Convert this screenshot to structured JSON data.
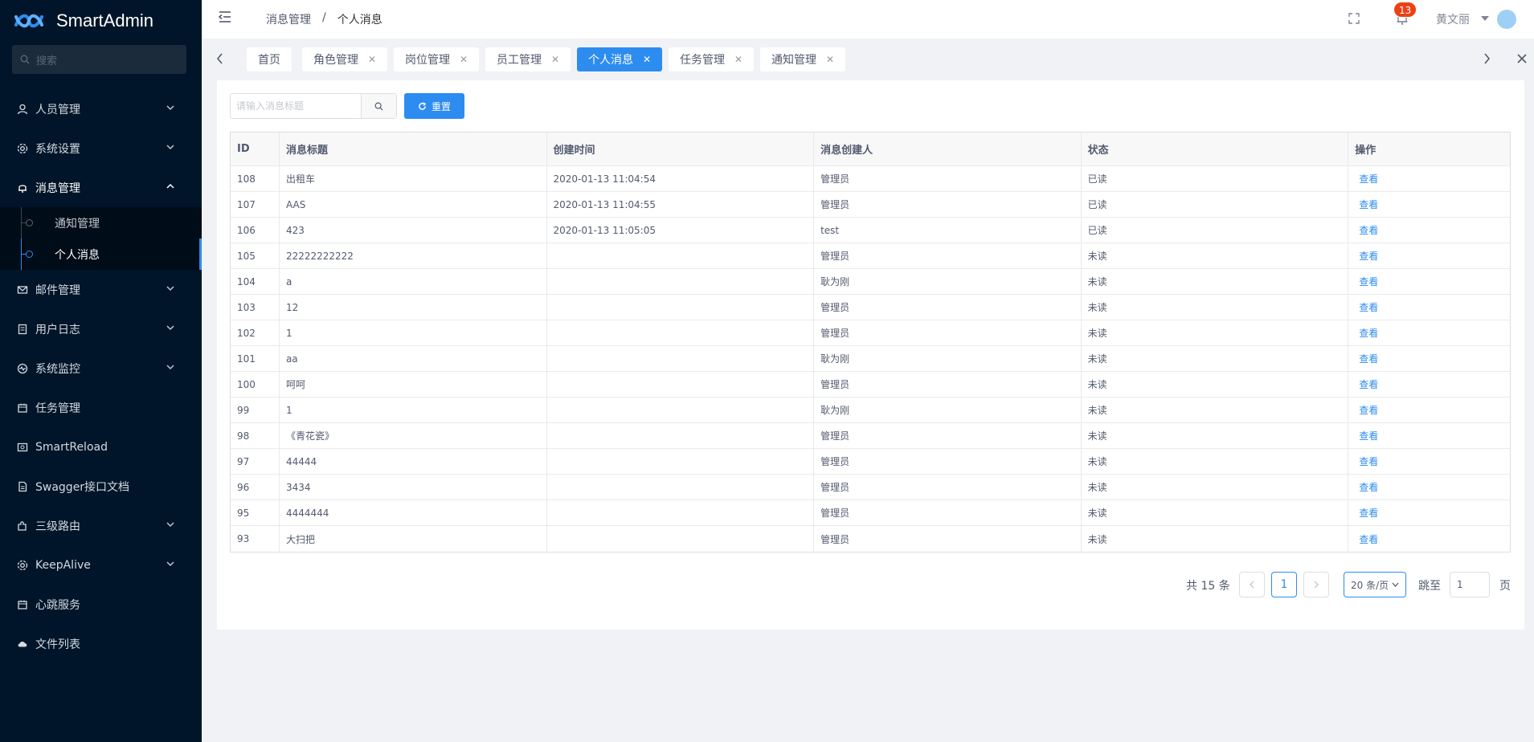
{
  "app": {
    "title": "SmartAdmin"
  },
  "sidebar": {
    "search_placeholder": "搜索",
    "items": [
      {
        "label": "人员管理",
        "icon": "user-icon",
        "expandable": true
      },
      {
        "label": "系统设置",
        "icon": "gear-icon",
        "expandable": true
      },
      {
        "label": "消息管理",
        "icon": "bell-icon",
        "expandable": true,
        "open": true
      },
      {
        "label": "邮件管理",
        "icon": "mail-icon",
        "expandable": true
      },
      {
        "label": "用户日志",
        "icon": "log-icon",
        "expandable": true
      },
      {
        "label": "系统监控",
        "icon": "monitor-icon",
        "expandable": true
      },
      {
        "label": "任务管理",
        "icon": "calendar-icon",
        "expandable": false
      },
      {
        "label": "SmartReload",
        "icon": "reload-icon",
        "expandable": false
      },
      {
        "label": "Swagger接口文档",
        "icon": "doc-icon",
        "expandable": false
      },
      {
        "label": "三级路由",
        "icon": "puzzle-icon",
        "expandable": true
      },
      {
        "label": "KeepAlive",
        "icon": "gear-icon",
        "expandable": true
      },
      {
        "label": "心跳服务",
        "icon": "heartbeat-icon",
        "expandable": false
      },
      {
        "label": "文件列表",
        "icon": "cloud-icon",
        "expandable": false
      }
    ],
    "submenu": [
      {
        "label": "通知管理",
        "active": false
      },
      {
        "label": "个人消息",
        "active": true
      }
    ]
  },
  "header": {
    "breadcrumb": [
      "消息管理",
      "/",
      "个人消息"
    ],
    "notification_count": "13",
    "user_name": "黄文丽"
  },
  "tabs": [
    {
      "label": "首页",
      "closable": false,
      "active": false
    },
    {
      "label": "角色管理",
      "closable": true,
      "active": false
    },
    {
      "label": "岗位管理",
      "closable": true,
      "active": false
    },
    {
      "label": "员工管理",
      "closable": true,
      "active": false
    },
    {
      "label": "个人消息",
      "closable": true,
      "active": true
    },
    {
      "label": "任务管理",
      "closable": true,
      "active": false
    },
    {
      "label": "通知管理",
      "closable": true,
      "active": false
    }
  ],
  "filters": {
    "search_placeholder": "请输入消息标题",
    "reset_label": "重置"
  },
  "table": {
    "columns": [
      "ID",
      "消息标题",
      "创建时间",
      "消息创建人",
      "状态",
      "操作"
    ],
    "action_label": "查看",
    "rows": [
      [
        "108",
        "出租车",
        "2020-01-13 11:04:54",
        "管理员",
        "已读"
      ],
      [
        "107",
        "AAS",
        "2020-01-13 11:04:55",
        "管理员",
        "已读"
      ],
      [
        "106",
        "423",
        "2020-01-13 11:05:05",
        "test",
        "已读"
      ],
      [
        "105",
        "22222222222",
        "",
        "管理员",
        "未读"
      ],
      [
        "104",
        "a",
        "",
        "耿为刚",
        "未读"
      ],
      [
        "103",
        "12",
        "",
        "管理员",
        "未读"
      ],
      [
        "102",
        "1",
        "",
        "管理员",
        "未读"
      ],
      [
        "101",
        "aa",
        "",
        "耿为刚",
        "未读"
      ],
      [
        "100",
        "呵呵",
        "",
        "管理员",
        "未读"
      ],
      [
        "99",
        "1",
        "",
        "耿为刚",
        "未读"
      ],
      [
        "98",
        "《青花瓷》",
        "",
        "管理员",
        "未读"
      ],
      [
        "97",
        "44444",
        "",
        "管理员",
        "未读"
      ],
      [
        "96",
        "3434",
        "",
        "管理员",
        "未读"
      ],
      [
        "95",
        "4444444",
        "",
        "管理员",
        "未读"
      ],
      [
        "93",
        "大扫把",
        "",
        "管理员",
        "未读"
      ]
    ]
  },
  "pagination": {
    "total_text": "共 15 条",
    "current_page": "1",
    "page_size": "20 条/页",
    "jump_label": "跳至",
    "jump_value": "1",
    "page_suffix": "页"
  },
  "colors": {
    "sidebar_bg": "#001529",
    "primary": "#2d8cf0",
    "badge": "#ed4014"
  }
}
